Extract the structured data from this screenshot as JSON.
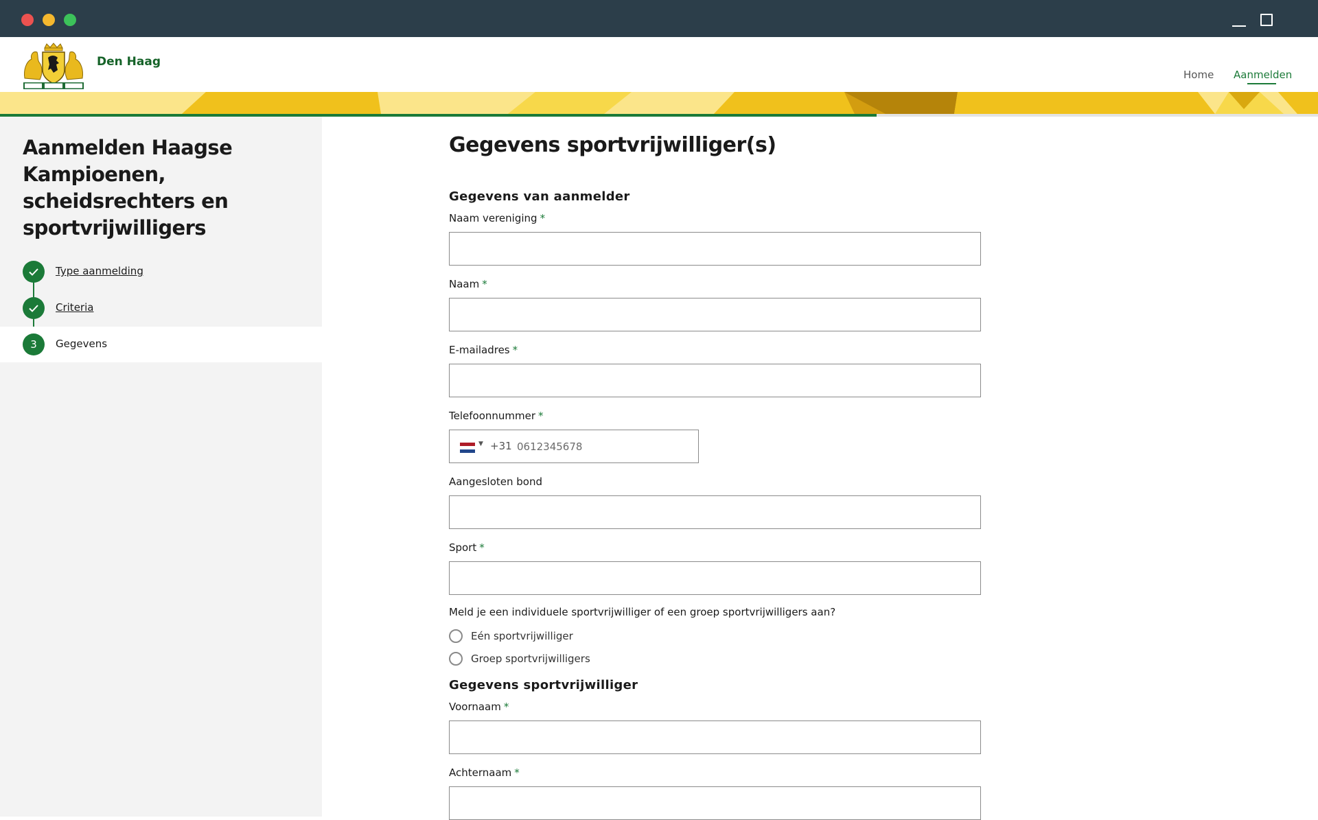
{
  "site": {
    "brand": "Den Haag",
    "nav": {
      "home": "Home",
      "aanmelden": "Aanmelden"
    },
    "progress_percent": 66.5,
    "colors": {
      "accent_green": "#1b7a38",
      "brand_green": "#166329",
      "banner_yellow": "#f0c11c"
    }
  },
  "sidebar": {
    "title": "Aanmelden Haagse Kampioenen, scheidsrechters en sportvrijwilligers",
    "steps": [
      {
        "label": "Type aanmelding",
        "state": "done",
        "icon": "check-icon"
      },
      {
        "label": "Criteria",
        "state": "done",
        "icon": "check-icon"
      },
      {
        "label": "Gegevens",
        "state": "active",
        "number": "3"
      }
    ]
  },
  "form": {
    "page_title": "Gegevens sportvrijwilliger(s)",
    "section_aanmelder": "Gegevens van aanmelder",
    "required_marker": "*",
    "fields": {
      "naam_vereniging": {
        "label": "Naam vereniging",
        "value": ""
      },
      "naam": {
        "label": "Naam",
        "value": ""
      },
      "email": {
        "label": "E-mailadres",
        "value": ""
      },
      "telefoon": {
        "label": "Telefoonnummer",
        "dial_code": "+31",
        "placeholder": "0612345678",
        "flag": "netherlands-flag-icon"
      },
      "bond": {
        "label": "Aangesloten bond",
        "value": ""
      },
      "sport": {
        "label": "Sport",
        "value": ""
      }
    },
    "question": "Meld je een individuele sportvrijwilliger of een groep sportvrijwilligers aan?",
    "options": [
      "Eén sportvrijwilliger",
      "Groep sportvrijwilligers"
    ],
    "section_vrijwilliger": "Gegevens sportvrijwilliger",
    "fields2": {
      "voornaam": {
        "label": "Voornaam",
        "value": ""
      },
      "achternaam": {
        "label": "Achternaam",
        "value": ""
      }
    }
  }
}
